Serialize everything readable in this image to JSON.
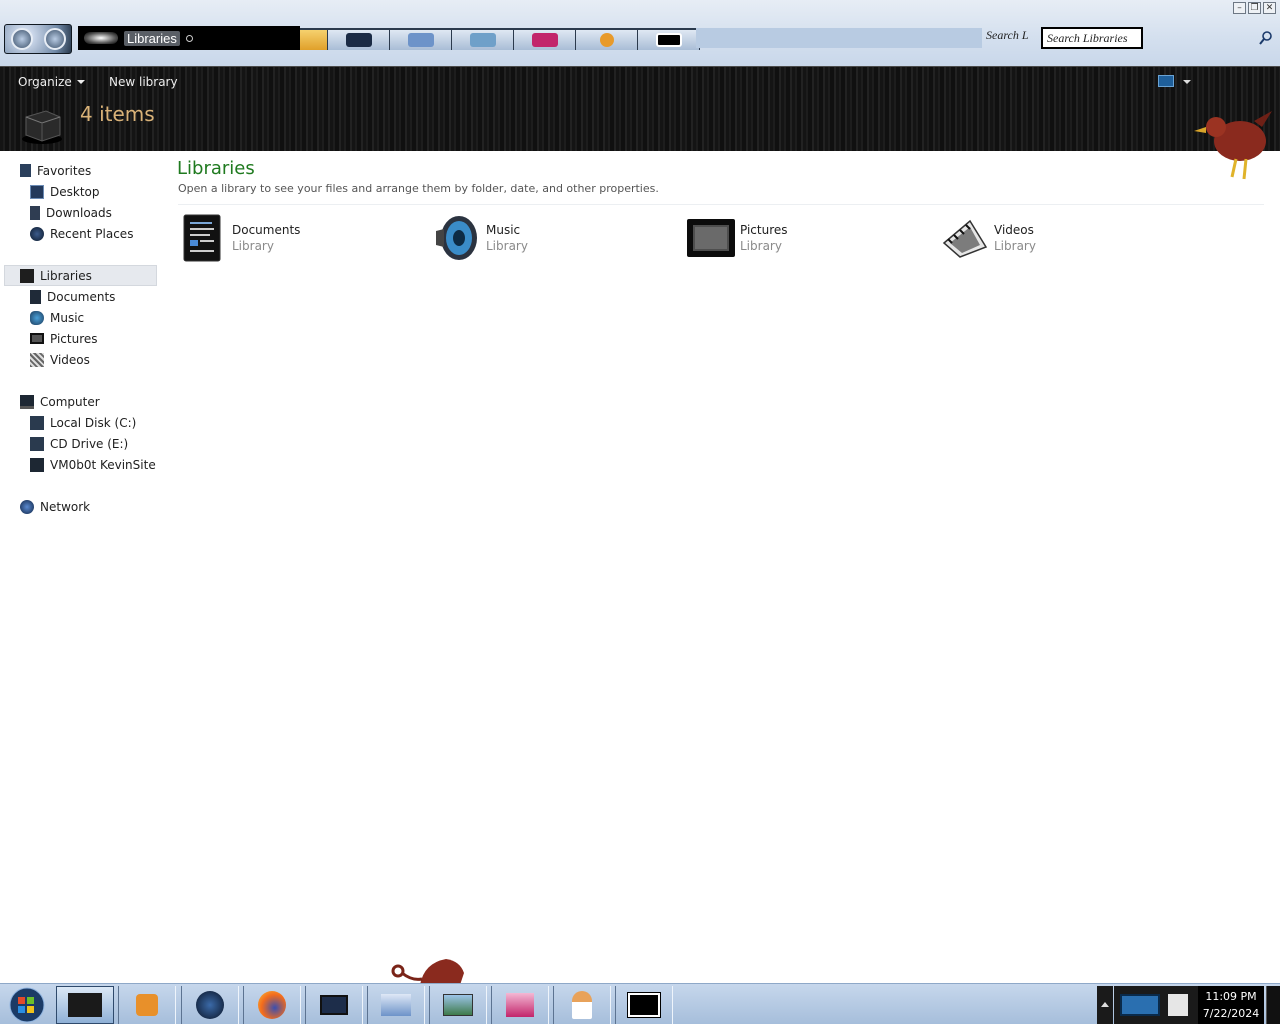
{
  "window": {
    "controls": [
      "minimize",
      "restore",
      "close"
    ]
  },
  "address_bar": {
    "crumb": "Libraries"
  },
  "search": {
    "label": "Search L",
    "placeholder": "Search Libraries"
  },
  "toolbar": {
    "organize_label": "Organize",
    "new_library_label": "New library",
    "item_count": "4 items"
  },
  "nav": {
    "favorites": {
      "label": "Favorites",
      "items": [
        {
          "label": "Desktop",
          "icon": "desktop-icon"
        },
        {
          "label": "Downloads",
          "icon": "downloads-icon"
        },
        {
          "label": "Recent Places",
          "icon": "recent-places-icon"
        }
      ]
    },
    "libraries": {
      "label": "Libraries",
      "items": [
        {
          "label": "Documents",
          "icon": "documents-icon"
        },
        {
          "label": "Music",
          "icon": "music-icon"
        },
        {
          "label": "Pictures",
          "icon": "pictures-icon"
        },
        {
          "label": "Videos",
          "icon": "videos-icon"
        }
      ]
    },
    "computer": {
      "label": "Computer",
      "items": [
        {
          "label": "Local Disk (C:)",
          "icon": "local-disk-icon"
        },
        {
          "label": "CD Drive (E:)",
          "icon": "cd-drive-icon"
        },
        {
          "label": "VM0b0t KevinSite",
          "icon": "network-drive-icon"
        }
      ]
    },
    "network": {
      "label": "Network"
    }
  },
  "content": {
    "title": "Libraries",
    "subtitle": "Open a library to see your files and arrange them by folder, date, and other properties.",
    "libraries": [
      {
        "name": "Documents",
        "kind": "Library",
        "icon": "documents-library-icon"
      },
      {
        "name": "Music",
        "kind": "Library",
        "icon": "music-library-icon"
      },
      {
        "name": "Pictures",
        "kind": "Library",
        "icon": "pictures-library-icon"
      },
      {
        "name": "Videos",
        "kind": "Library",
        "icon": "videos-library-icon"
      }
    ]
  },
  "taskbar": {
    "time": "11:09 PM",
    "date": "7/22/2024",
    "buttons": [
      "explorer",
      "media-player",
      "globe",
      "firefox",
      "monitor",
      "keyboard",
      "photos",
      "jar",
      "user",
      "7zip"
    ]
  },
  "colors": {
    "title_green": "#1f7a1f",
    "count_gold": "#d9b278",
    "toolbar_dark": "#141414",
    "taskbar_blue": "#b6cae3"
  }
}
